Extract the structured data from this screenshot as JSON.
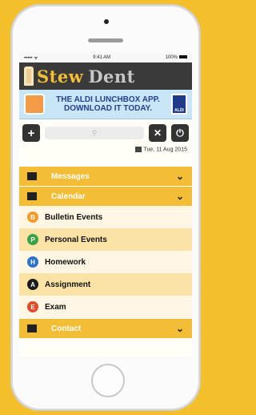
{
  "status": {
    "time": "9:41 AM",
    "battery": "100%"
  },
  "header": {
    "brand_part1": "Stew",
    "brand_part2": "Dent"
  },
  "ad": {
    "line1": "THE ALDI LUNCHBOX APP.",
    "line2": "DOWNLOAD IT TODAY.",
    "logo": "ALDI"
  },
  "toolbar": {
    "date": "Tue, 11 Aug 2015"
  },
  "menu": {
    "messages": "Messages",
    "calendar": "Calendar",
    "contact": "Contact",
    "items": [
      {
        "letter": "B",
        "label": "Bulletin Events",
        "color": "#f39a2b"
      },
      {
        "letter": "P",
        "label": "Personal Events",
        "color": "#3aa34a"
      },
      {
        "letter": "H",
        "label": "Homework",
        "color": "#2a73c9"
      },
      {
        "letter": "A",
        "label": "Assignment",
        "color": "#1b1b1b"
      },
      {
        "letter": "E",
        "label": "Exam",
        "color": "#e24a2a"
      }
    ]
  },
  "colors": {
    "accent": "#f3bd35",
    "background": "#f3c02b"
  }
}
